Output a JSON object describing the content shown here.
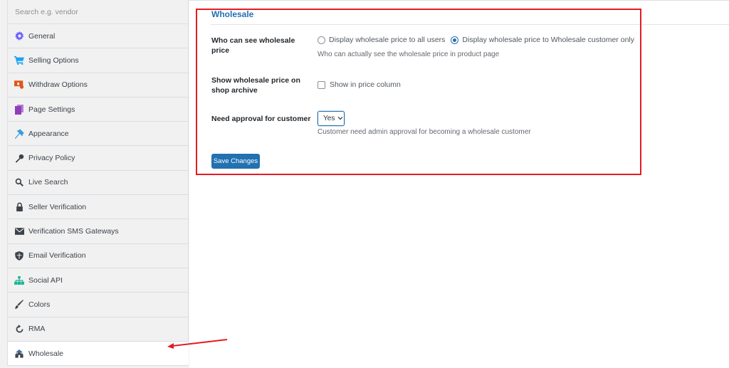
{
  "sidebar": {
    "search_placeholder": "Search e.g. vendor",
    "items": [
      {
        "label": "General",
        "icon": "gear-icon",
        "color": "#6c63ff"
      },
      {
        "label": "Selling Options",
        "icon": "cart-icon",
        "color": "#1ea1f2"
      },
      {
        "label": "Withdraw Options",
        "icon": "withdraw-icon",
        "color": "#e0561b"
      },
      {
        "label": "Page Settings",
        "icon": "pages-icon",
        "color": "#8f3fb8"
      },
      {
        "label": "Appearance",
        "icon": "brush-pin-icon",
        "color": "#3a9ce0"
      },
      {
        "label": "Privacy Policy",
        "icon": "key-icon",
        "color": "#3c434a"
      },
      {
        "label": "Live Search",
        "icon": "search-icon",
        "color": "#3c434a"
      },
      {
        "label": "Seller Verification",
        "icon": "lock-icon",
        "color": "#3c434a"
      },
      {
        "label": "Verification SMS Gateways",
        "icon": "envelope-icon",
        "color": "#3c434a"
      },
      {
        "label": "Email Verification",
        "icon": "shield-icon",
        "color": "#3c434a"
      },
      {
        "label": "Social API",
        "icon": "sitemap-icon",
        "color": "#1ab394"
      },
      {
        "label": "Colors",
        "icon": "paintbrush-icon",
        "color": "#3c434a"
      },
      {
        "label": "RMA",
        "icon": "refresh-icon",
        "color": "#3c434a"
      },
      {
        "label": "Wholesale",
        "icon": "wholesale-icon",
        "color": "#3c434a",
        "active": true
      }
    ]
  },
  "main": {
    "title": "Wholesale",
    "rows": {
      "who_can_see": {
        "label": "Who can see wholesale price",
        "options": [
          {
            "label": "Display wholesale price to all users",
            "checked": false
          },
          {
            "label": "Display wholesale price to Wholesale customer only",
            "checked": true
          }
        ],
        "description": "Who can actually see the wholesale price in product page"
      },
      "show_on_archive": {
        "label": "Show wholesale price on shop archive",
        "checkbox_label": "Show in price column",
        "checked": false
      },
      "need_approval": {
        "label": "Need approval for customer",
        "selected": "Yes",
        "description": "Customer need admin approval for becoming a wholesale customer"
      }
    },
    "save_label": "Save Changes"
  },
  "colors": {
    "accent": "#2271b1",
    "annotation": "#e31b23"
  }
}
